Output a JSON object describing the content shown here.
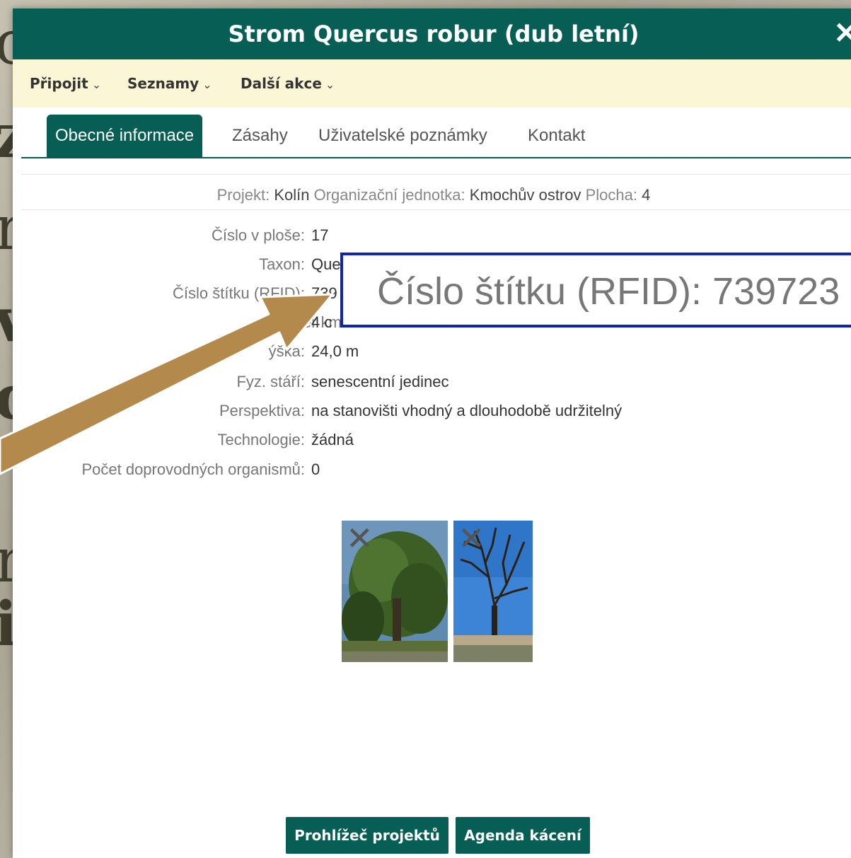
{
  "modal": {
    "title": "Strom Quercus robur (dub letní)",
    "close_symbol": "✕"
  },
  "menu": [
    {
      "label": "Připojit"
    },
    {
      "label": "Seznamy"
    },
    {
      "label": "Další akce"
    }
  ],
  "tabs": [
    {
      "label": "Obecné informace",
      "active": true
    },
    {
      "label": "Zásahy",
      "active": false
    },
    {
      "label": "Uživatelské poznámky",
      "active": false
    },
    {
      "label": "Kontakt",
      "active": false
    }
  ],
  "project_line": {
    "project_label": "Projekt:",
    "project_value": "Kolín",
    "unit_label": "Organizační jednotka:",
    "unit_value": "Kmochův ostrov",
    "area_label": "Plocha:",
    "area_value": "4"
  },
  "fields": [
    {
      "label": "Číslo v ploše:",
      "value": "17"
    },
    {
      "label": "Taxon:",
      "value": "Que"
    },
    {
      "label": "Číslo štítku (RFID):",
      "value": "739"
    },
    {
      "label": "Průměr km",
      "value": "4 c"
    },
    {
      "label": "ýška:",
      "value": "24,0 m"
    },
    {
      "label": "Fyz. stáří:",
      "value": "senescentní jedinec"
    },
    {
      "label": "Perspektiva:",
      "value": "na stanovišti vhodný a dlouhodobě udržitelný"
    },
    {
      "label": "Technologie:",
      "value": "žádná"
    },
    {
      "label": "Počet doprovodných organismů:",
      "value": "0"
    }
  ],
  "photos": [
    {
      "name": "tree-photo-summer",
      "remove_symbol": "✕"
    },
    {
      "name": "tree-photo-winter",
      "remove_symbol": "✕"
    }
  ],
  "buttons": {
    "project_viewer": "Prohlížeč projektů",
    "felling_agenda": "Agenda kácení"
  },
  "callout": {
    "zoom_text": "Číslo štítku (RFID): 739723",
    "box_color": "#1222b4",
    "arrow_color": "#b48a4c"
  },
  "colors": {
    "header": "#075e54",
    "menubar": "#fbf7d6"
  }
}
